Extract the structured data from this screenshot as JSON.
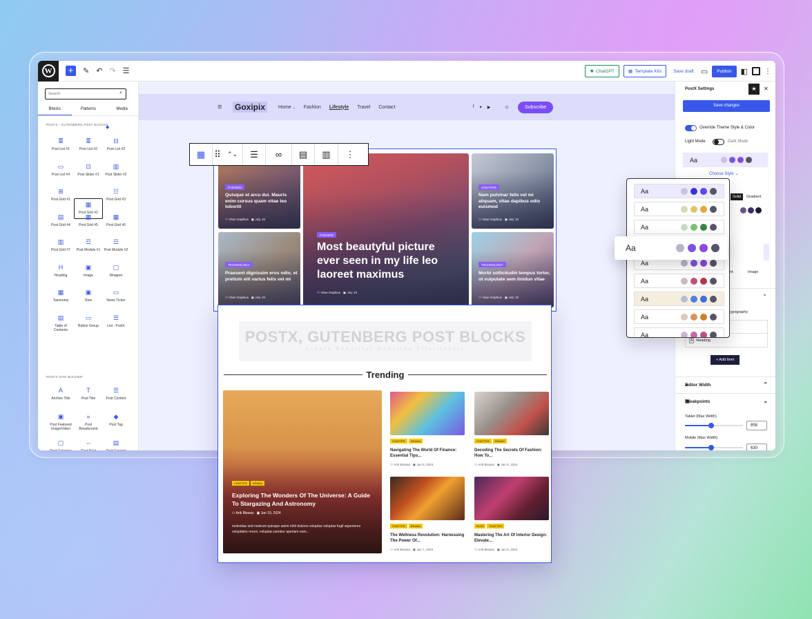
{
  "topbar": {
    "chatgpt": "ChatGPT",
    "template_kits": "Template Kits",
    "save_draft": "Save draft",
    "publish": "Publish"
  },
  "inserter": {
    "search_placeholder": "Search",
    "tabs": [
      "Blocks",
      "Patterns",
      "Media"
    ],
    "section1": "POSTX - GUTENBERG POST BLOCKS",
    "section2": "POSTX SITE BUILDER",
    "blocks": [
      "Post List #1",
      "Post List #2",
      "Post List #3",
      "Post List #4",
      "Post Slider #1",
      "Post Slider #2",
      "Post Grid #1",
      "Post Grid #2",
      "Post Grid #3",
      "Post Grid #4",
      "Post Grid #5",
      "Post Grid #6",
      "Post Grid #7",
      "Post Module #1",
      "Post Module #2",
      "Heading",
      "Image",
      "Wrapper",
      "Taxonomy",
      "Row",
      "News Ticker",
      "Table of Contents",
      "Button Group",
      "List - PostX"
    ],
    "builder_blocks": [
      "Archive Title",
      "Post Title",
      "Post Content",
      "Post Featured Image/Video",
      "Post Breadcrumb",
      "Post Tag",
      "Post Category",
      "Post Next Previous",
      "Post Excerpt"
    ]
  },
  "site": {
    "logo": "Goxipix",
    "nav": [
      "Home",
      "Fashion",
      "Lifestyle",
      "Travel",
      "Contact"
    ],
    "subscribe": "Subscribe"
  },
  "grid": {
    "cards": [
      {
        "tag": "FASHION",
        "title": "Quisque et arcu dui. Mauris enim cursus quam vitae leo lobortit",
        "author": "Vitae Dapibus",
        "date": "July 19"
      },
      {
        "tag": "TECHNOLOGY",
        "title": "Praesent dignissim eros odio, et pretium elit varius felis vel mi",
        "author": "Vitae Dapibus",
        "date": "July 19"
      },
      {
        "tag": "FASHION",
        "title": "Most beautyful picture ever seen in my life leo laoreet maximus",
        "author": "Vitae Dapibus",
        "date": "July 19"
      },
      {
        "tag": "CREATIVE",
        "title": "Nam pulvinar felis vel mi aliquam, vitae dapibus odio euismod",
        "author": "Vitae Dapibus",
        "date": "July 19"
      },
      {
        "tag": "TECHNOLOGY",
        "title": "Morbi sollicitudin tempus tortor, ut vulputate sem tinidun vitae",
        "author": "Vitae Dapibus",
        "date": "July 19"
      }
    ]
  },
  "block2": {
    "head1": "POSTX, GUTENBERG POST BLOCKS",
    "head2": "Create Beautiful Websites Effortlessly",
    "trending": "Trending",
    "big": {
      "tags": [
        "CHATTER",
        "DRAMA"
      ],
      "title": "Exploring The Wonders Of The Universe: A Guide To Stargazing And Astronomy",
      "author": "Arik Biswas",
      "date": "Jan 10, 2024",
      "excerpt": "molestias sed nostrum quinque animi nihil dolores voluptas voluptas fugit asperiores voluptates rerum. voluptas pariatur aperiam eum..."
    },
    "small": [
      {
        "tags": [
          "CHATTER",
          "DRAMA"
        ],
        "title": "Navigating The World Of Finance: Essential Tips...",
        "author": "Arik Biswas",
        "date": "Jan 9, 2024"
      },
      {
        "tags": [
          "CHATTER",
          "DRAMA"
        ],
        "title": "Decoding The Secrets Of Fashion: How To...",
        "author": "Arik Biswas",
        "date": "Jan 6, 2024"
      },
      {
        "tags": [
          "CHATTER",
          "DRAMA"
        ],
        "title": "The Wellness Revolution: Harnessing The Power Of...",
        "author": "Arik Biswas",
        "date": "Jan 7, 2024"
      },
      {
        "tags": [
          "BUZZ",
          "CHATTER"
        ],
        "title": "Mastering The Art Of Interior Design: Elevate...",
        "author": "Arik Biswas",
        "date": "Jan 6, 2024"
      }
    ]
  },
  "settings": {
    "title": "PostX Settings",
    "save": "Save changes",
    "override": "Override Theme Style & Color",
    "light": "Light Mode",
    "dark": "Dark Mode",
    "aa": "Aa",
    "choose_style": "Choose Style",
    "solid": "Solid",
    "gradient": "Gradient",
    "ent": "ent",
    "image": "Image",
    "typo": "e Typography",
    "heading": "Heading",
    "add_item": "+ Add Item",
    "editor_width": "Editor Width",
    "breakpoints": "Breakpoints",
    "tablet": "Tablet (Max Width)",
    "tablet_val": "858",
    "mobile": "Mobile (Max Width)",
    "mobile_val": "630"
  },
  "palettes": [
    [
      "#c9c3df",
      "#3b2fd9",
      "#5a49ee",
      "#555566"
    ],
    [
      "#d6dcb8",
      "#dcc66b",
      "#e7a53b",
      "#555566"
    ],
    [
      "#c7dbc3",
      "#7bc075",
      "#37873f",
      "#555566"
    ],
    [
      "#b9b6cb",
      "#7b55e2",
      "#8a48e0",
      "#555566"
    ],
    [
      "#c9bac6",
      "#c25273",
      "#b53547",
      "#555566"
    ],
    [
      "#b7bdd0",
      "#4c7fe0",
      "#3f6fdd",
      "#555566"
    ],
    [
      "#d9ccb8",
      "#d9935c",
      "#c9822b",
      "#555566"
    ],
    [
      "#c9b6cc",
      "#c46aa8",
      "#bb5088",
      "#555566"
    ]
  ],
  "colors": {
    "accent": "#3858e9",
    "purple": "#7b4df4"
  }
}
